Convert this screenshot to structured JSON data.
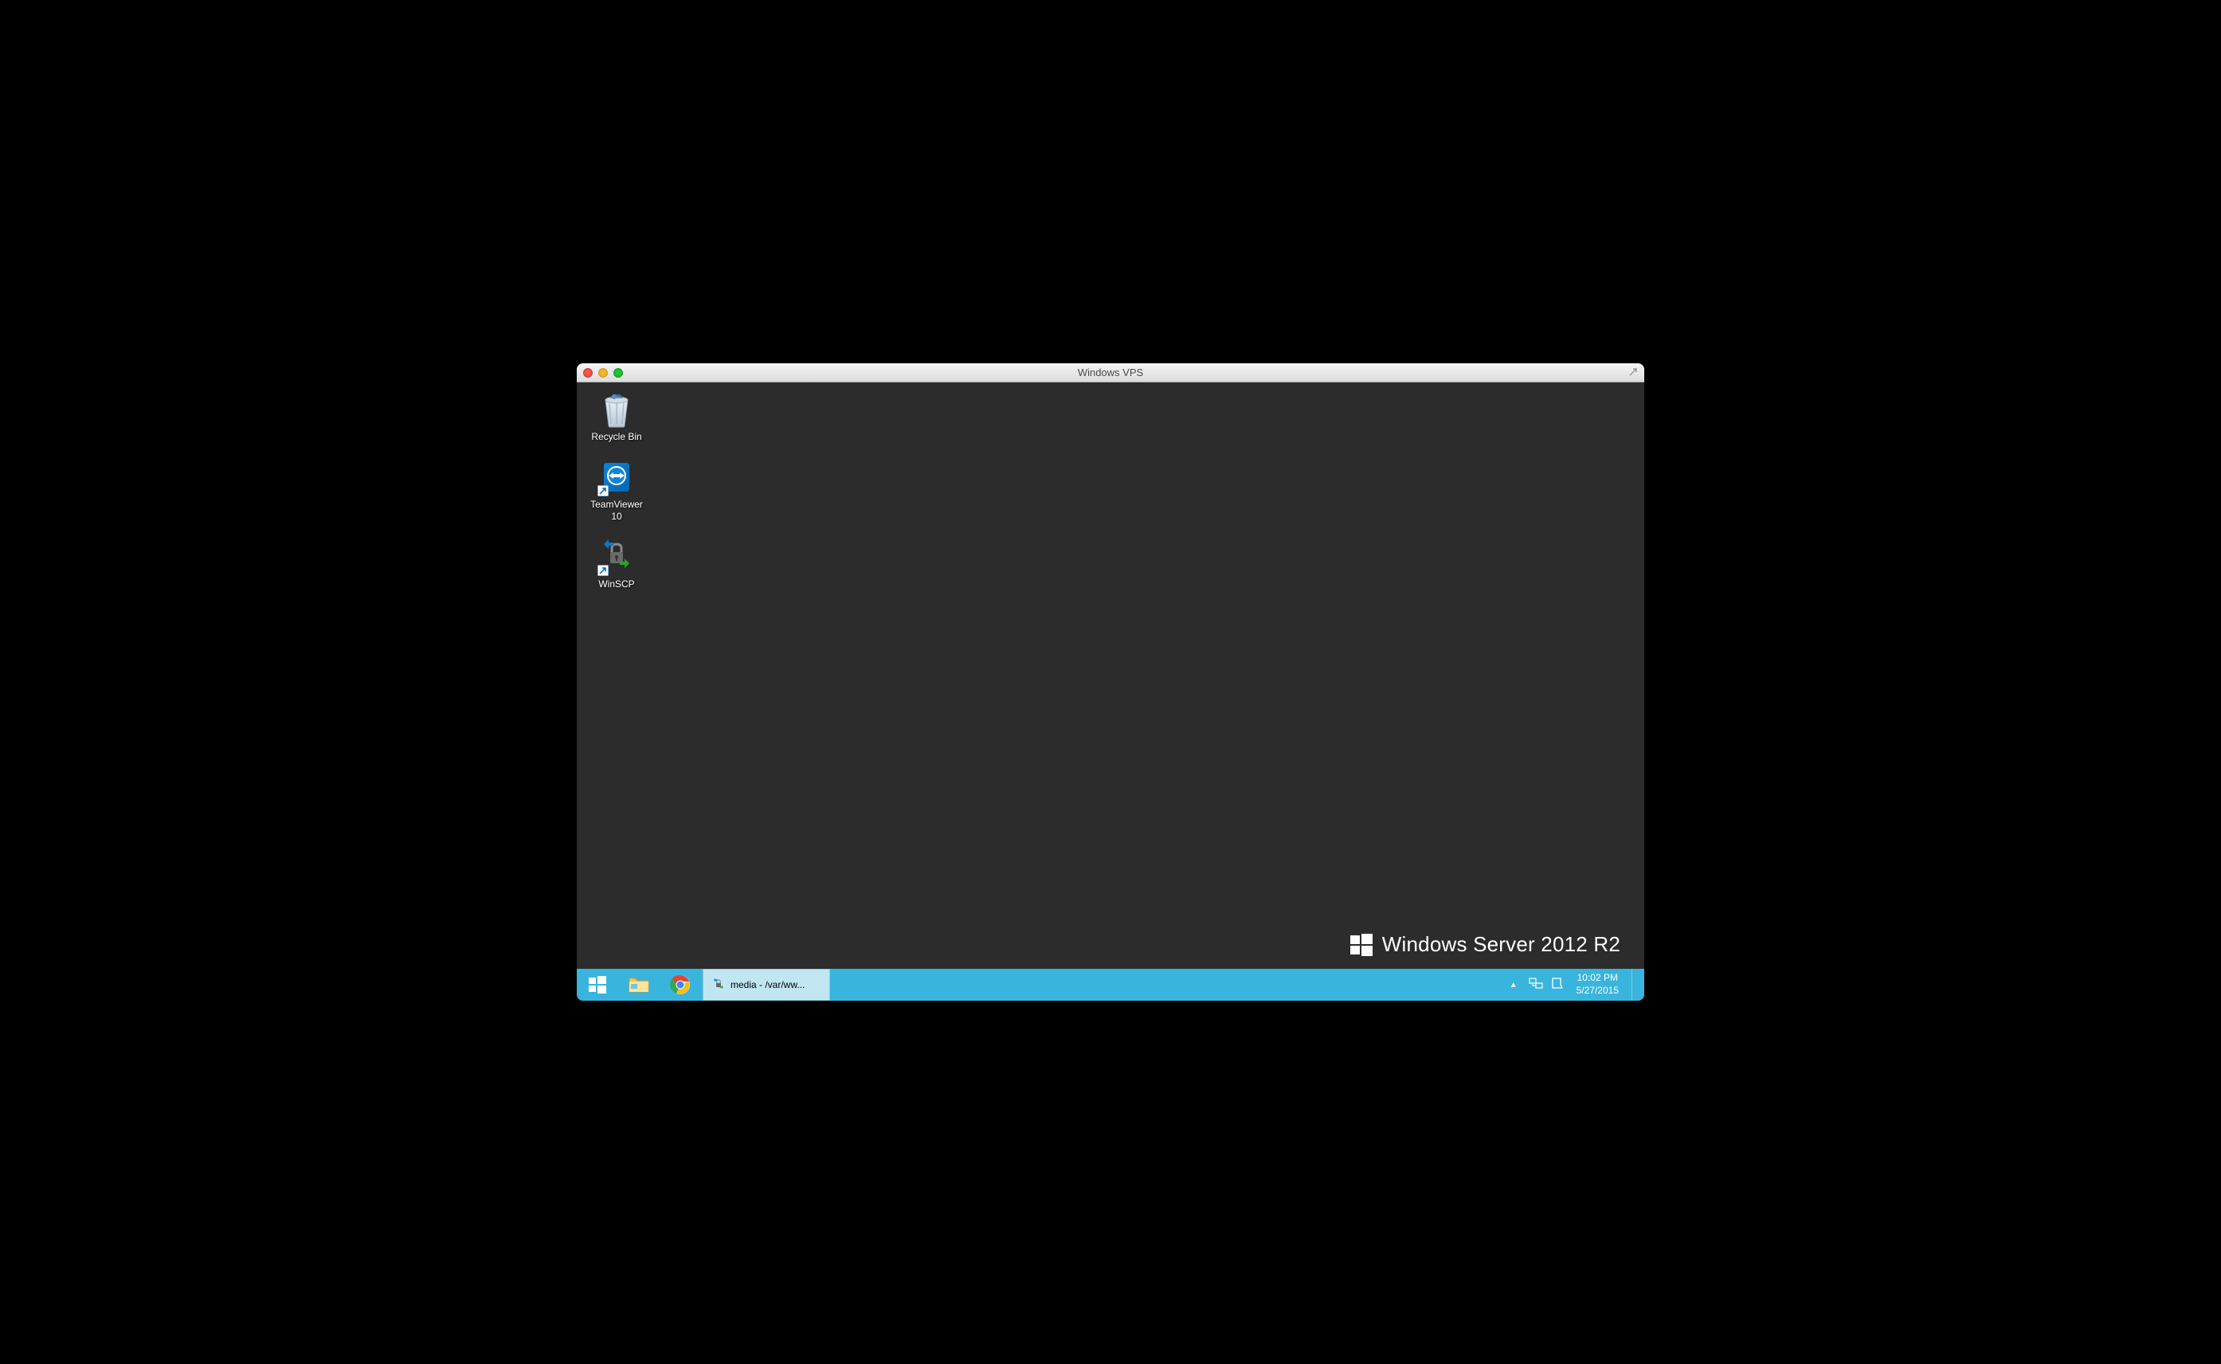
{
  "mac_window": {
    "title": "Windows VPS"
  },
  "desktop": {
    "icons": [
      {
        "label": "Recycle Bin",
        "type": "recycle-bin"
      },
      {
        "label": "TeamViewer\n10",
        "type": "teamviewer"
      },
      {
        "label": "WinSCP",
        "type": "winscp"
      }
    ],
    "watermark": "Windows Server 2012 R2"
  },
  "taskbar": {
    "task_items": [
      {
        "label": "media - /var/ww...",
        "app": "winscp"
      }
    ],
    "clock": {
      "time": "10:02 PM",
      "date": "5/27/2015"
    }
  }
}
